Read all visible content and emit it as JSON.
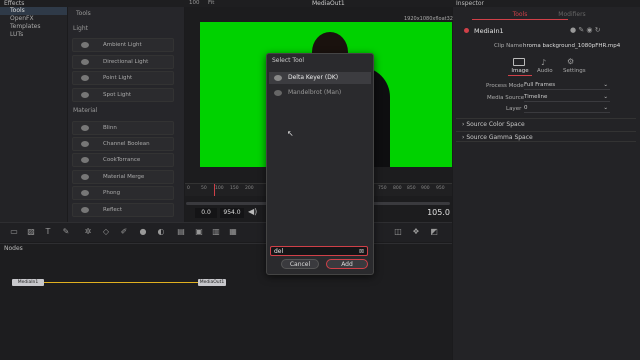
{
  "effects_panel": {
    "title": "Effects",
    "tree": [
      "Tools",
      "OpenFX",
      "Templates",
      "LUTs"
    ],
    "tools_header": "Tools",
    "light_label": "Light",
    "light_tools": [
      "Ambient Light",
      "Directional Light",
      "Point Light",
      "Spot Light"
    ],
    "material_label": "Material",
    "material_tools": [
      "Blinn",
      "Channel Boolean",
      "CookTorrance",
      "Material Merge",
      "Phong",
      "Reflect"
    ]
  },
  "viewer": {
    "top_left_label": "100",
    "top_label2": "Fit",
    "title": "MediaOut1",
    "resolution": "1920x1080xfloat32",
    "ruler_ticks": [
      "0",
      "50",
      "100",
      "150",
      "200",
      "750",
      "800",
      "850",
      "900",
      "950"
    ],
    "time_start": "0.0",
    "time_end": "954.0",
    "current_frame": "105.0"
  },
  "dialog": {
    "title": "Select Tool",
    "items": [
      "Delta Keyer (DK)",
      "Mandelbrot (Man)"
    ],
    "search_value": "del",
    "cancel_label": "Cancel",
    "add_label": "Add"
  },
  "inspector": {
    "title": "Inspector",
    "tab_tools": "Tools",
    "tab_modifiers": "Modifiers",
    "node_name": "MediaIn1",
    "clip_name_label": "Clip Name",
    "clip_name_value": "hroma background_1080pFHR.mp4",
    "subtabs": [
      "Image",
      "Audio",
      "Settings"
    ],
    "process_mode_label": "Process Mode",
    "process_mode_value": "Full Frames",
    "media_source_label": "Media Source",
    "media_source_value": "Timeline",
    "layer_label": "Layer",
    "layer_value": "0",
    "sections": [
      "Source Color Space",
      "Source Gamma Space"
    ]
  },
  "nodes": {
    "title": "Nodes",
    "node_in": "MediaIn1",
    "node_out": "MediaOut1"
  },
  "colors": {
    "green_screen": "#00d200",
    "accent_red": "#d04048",
    "link_yellow": "#e0b020"
  }
}
